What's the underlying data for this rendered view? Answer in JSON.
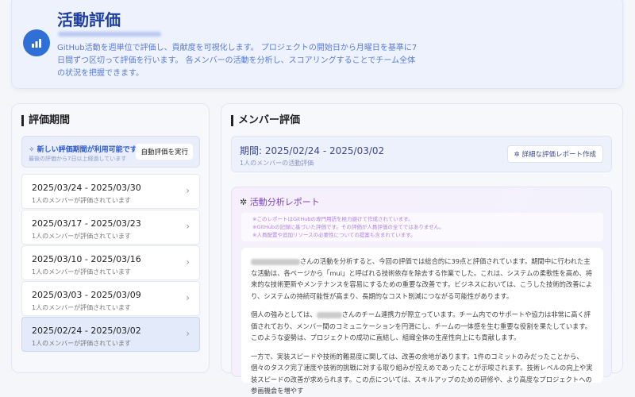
{
  "header": {
    "title": "活動評価",
    "description": "GitHub活動を週単位で評価し、貢献度を可視化します。 プロジェクトの開始日から月曜日を基準に7日間ずつ区切って評価を行います。 各メンバーの活動を分析し、スコアリングすることでチーム全体の状況を把握できます。"
  },
  "periods": {
    "title": "評価期間",
    "notice": {
      "title": "✧ 新しい評価期間が利用可能です",
      "subtitle": "最後の評価から7日以上経過しています",
      "button": "自動評価を実行"
    },
    "items": [
      {
        "range": "2025/03/24 - 2025/03/30",
        "status": "1人のメンバーが評価されています"
      },
      {
        "range": "2025/03/17 - 2025/03/23",
        "status": "1人のメンバーが評価されています"
      },
      {
        "range": "2025/03/10 - 2025/03/16",
        "status": "1人のメンバーが評価されています"
      },
      {
        "range": "2025/03/03 - 2025/03/09",
        "status": "1人のメンバーが評価されています"
      },
      {
        "range": "2025/02/24 - 2025/03/02",
        "status": "1人のメンバーが評価されています"
      }
    ]
  },
  "members": {
    "title": "メンバー評価",
    "period": "期間: 2025/02/24 - 2025/03/02",
    "count": "1人のメンバーの活動評価",
    "report_button": "詳細な評価レポート作成",
    "report": {
      "title": "活動分析レポート",
      "notes": [
        "※このレポートはGitHubの専門用語を極力避けて作成されています。",
        "※GitHubの記録に基づいた評価です。その評価が人員評価の全てではありません。",
        "※人員配置や追加リソースの必要性についての提案も含まれています。"
      ],
      "p1": "さんの活動を分析すると、今回の評価では総合的に39点と評価されています。期間中に行われた主な活動は、各ページから「mui」と呼ばれる技術依存を除去する作業でした。これは、システムの柔軟性を高め、将来的な技術更新やメンテナンスを容易にするための重要な改善です。ビジネスにおいては、こうした技術的改善により、システムの持続可能性が高まり、長期的なコスト削減につながる可能性があります。",
      "p2a": "個人の強みとしては、",
      "p2b": "さんのチーム連携力が際立っています。チーム内でのサポートや協力は非常に高く評価されており、メンバー間のコミュニケーションを円滑にし、チームの一体感を生む重要な役割を果たしています。このような姿勢は、プロジェクトの成功に直結し、組織全体の生産性向上にも貢献します。",
      "p3": "一方で、実装スピードや技術的難易度に関しては、改善の余地があります。1件のコミットのみだったことから、個々のタスク完了速度や技術的挑戦に対する取り組みが控えめであったことが示唆されます。技術レベルの向上や実装スピードの改善が求められます。この点については、スキルアップのための研修や、より高度なプロジェクトへの参画機会を増やす"
    }
  }
}
